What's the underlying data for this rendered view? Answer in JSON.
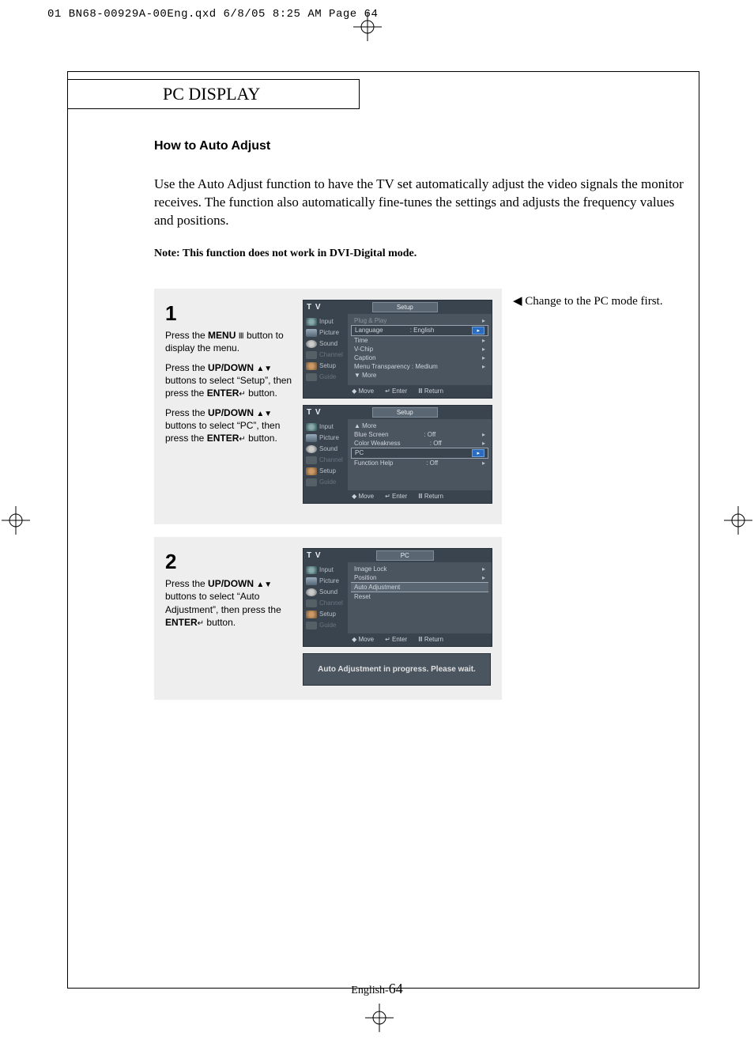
{
  "print_header": "01 BN68-00929A-00Eng.qxd  6/8/05 8:25 AM  Page 64",
  "section_title_prefix": "PC D",
  "section_title_sc": "ISPLAY",
  "heading": "How to Auto Adjust",
  "intro": "Use the Auto Adjust function to have the TV set automatically adjust the video signals the monitor receives. The function also automatically fine-tunes the settings and adjusts the frequency values and positions.",
  "note": "Note: This function does not work in DVI-Digital mode.",
  "side_note": "Change to the PC mode first.",
  "step1": {
    "num": "1",
    "p1a": "Press the ",
    "p1b": "MENU",
    "p1c": " button to display the menu.",
    "p2a": "Press the ",
    "p2b": "UP/DOWN",
    "p2c": " buttons to select “Setup”, then press the ",
    "p2d": "ENTER",
    "p2e": " button.",
    "p3a": "Press the ",
    "p3b": "UP/DOWN",
    "p3c": " buttons to select “PC”, then press the ",
    "p3d": "ENTER",
    "p3e": " button."
  },
  "step2": {
    "num": "2",
    "p1a": "Press the ",
    "p1b": "UP/DOWN",
    "p1c": " buttons to select “Auto Adjustment”, then press the ",
    "p1d": "ENTER",
    "p1e": " button."
  },
  "osd_nav": {
    "input": "Input",
    "picture": "Picture",
    "sound": "Sound",
    "channel": "Channel",
    "setup": "Setup",
    "guide": "Guide"
  },
  "osd_titles": {
    "tv": "T V",
    "setup": "Setup",
    "pc": "PC"
  },
  "osd_setup1": {
    "r1": "Plug & Play",
    "r2": "Language",
    "r2v": ": English",
    "r3": "Time",
    "r4": "V-Chip",
    "r5": "Caption",
    "r6": "Menu Transparency : Medium",
    "r7": "▼ More"
  },
  "osd_setup2": {
    "r0": "▲ More",
    "r1": "Blue Screen",
    "r1v": ": Off",
    "r2": "Color Weakness",
    "r2v": ": Off",
    "r3": "PC",
    "r4": "Function Help",
    "r4v": ": Off"
  },
  "osd_pc": {
    "r1": "Image Lock",
    "r2": "Position",
    "r3": "Auto Adjustment",
    "r4": "Reset"
  },
  "osd_footer": {
    "move": "Move",
    "enter": "Enter",
    "return": "Return"
  },
  "auto_progress": "Auto Adjustment in progress. Please wait.",
  "page_prefix": "English-",
  "page_num": "64",
  "glyph_menu": "Ⅲ",
  "glyph_updown": "▲▼",
  "glyph_enter": "↵",
  "glyph_move": "◆",
  "glyph_enter_btn": "↵",
  "glyph_return_btn": "Ⅲ",
  "glyph_arr": "▸"
}
